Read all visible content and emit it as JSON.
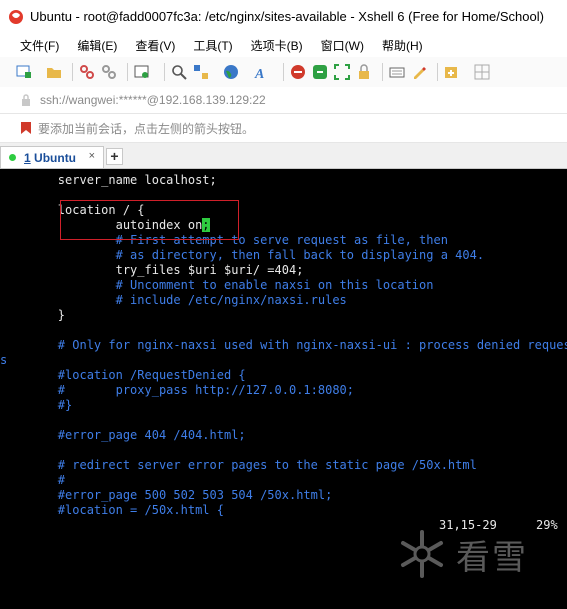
{
  "window": {
    "title": "Ubuntu - root@fadd0007fc3a: /etc/nginx/sites-available - Xshell 6 (Free for Home/School)"
  },
  "menu": [
    "文件(F)",
    "编辑(E)",
    "查看(V)",
    "工具(T)",
    "选项卡(B)",
    "窗口(W)",
    "帮助(H)"
  ],
  "address": "ssh://wangwei:******@192.168.139.129:22",
  "hint": "要添加当前会话，点击左侧的箭头按钮。",
  "tab": {
    "index": "1",
    "name": "Ubuntu",
    "close": "×",
    "new": "+"
  },
  "terminal": {
    "l01": "        server_name localhost;",
    "l02": "",
    "l03": "        location / {",
    "l04a": "                autoindex on",
    "l04b": ";",
    "l05": "                # First attempt to serve request as file, then",
    "l06": "                # as directory, then fall back to displaying a 404.",
    "l07": "                try_files $uri $uri/ =404;",
    "l08": "                # Uncomment to enable naxsi on this location",
    "l09": "                # include /etc/nginx/naxsi.rules",
    "l10": "        }",
    "l11": "",
    "l12": "        # Only for nginx-naxsi used with nginx-naxsi-ui : process denied request",
    "l13": "s",
    "l14": "",
    "l15": "        #location /RequestDenied {",
    "l16": "        #       proxy_pass http://127.0.0.1:8080;",
    "l17": "        #}",
    "l18": "",
    "l19": "        #error_page 404 /404.html;",
    "l20": "",
    "l21": "        # redirect server error pages to the static page /50x.html",
    "l22": "        #",
    "l23": "        #error_page 500 502 503 504 /50x.html;",
    "l24": "        #location = /50x.html {",
    "status_pos": "31,15-29",
    "status_pct": "29%"
  },
  "watermark": "看雪",
  "colors": {
    "comment": "#3f7ee8",
    "cursor": "#2ecc40",
    "highlight_box": "#d0202a",
    "terminal_bg": "#000000"
  }
}
